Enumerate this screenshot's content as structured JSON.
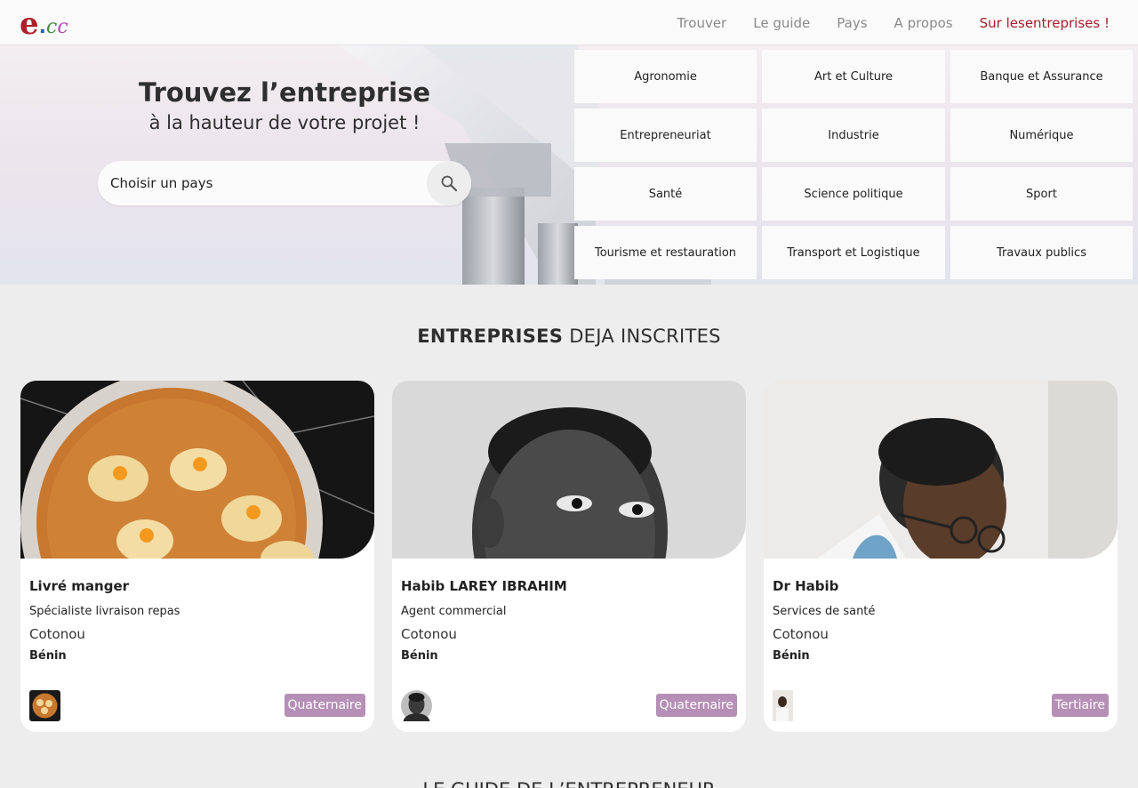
{
  "nav": {
    "logo": {
      "e": "e",
      "dot": ".",
      "c1": "c",
      "c2": "c"
    },
    "links": [
      "Trouver",
      "Le guide",
      "Pays",
      "A propos"
    ],
    "cta": "Sur lesentreprises !"
  },
  "hero": {
    "title": "Trouvez l’entreprise",
    "subtitle": "à la hauteur de votre projet !",
    "search_placeholder": "Choisir un pays",
    "categories": [
      "Agronomie",
      "Art et Culture",
      "Banque et Assurance",
      "Entrepreneuriat",
      "Industrie",
      "Numérique",
      "Santé",
      "Science politique",
      "Sport",
      "Tourisme et restauration",
      "Transport et Logistique",
      "Travaux publics"
    ]
  },
  "section": {
    "title_bold": "ENTREPRISES",
    "title_rest": " DEJA INSCRITES"
  },
  "cards": [
    {
      "name": "Livré manger",
      "role": "Spécialiste livraison repas",
      "city": "Cotonou",
      "country": "Bénin",
      "badge": "Quaternaire"
    },
    {
      "name": "Habib LAREY IBRAHIM",
      "role": "Agent commercial",
      "city": "Cotonou",
      "country": "Bénin",
      "badge": "Quaternaire"
    },
    {
      "name": "Dr Habib",
      "role": "Services de santé",
      "city": "Cotonou",
      "country": "Bénin",
      "badge": "Tertiaire"
    }
  ],
  "next_section_title": "LE GUIDE DE L’ENTREPRENEUR",
  "colors": {
    "accent": "#a1222b",
    "badge": "#b58fb5",
    "background": "#ededed"
  },
  "icons": {
    "search": "search-icon"
  }
}
